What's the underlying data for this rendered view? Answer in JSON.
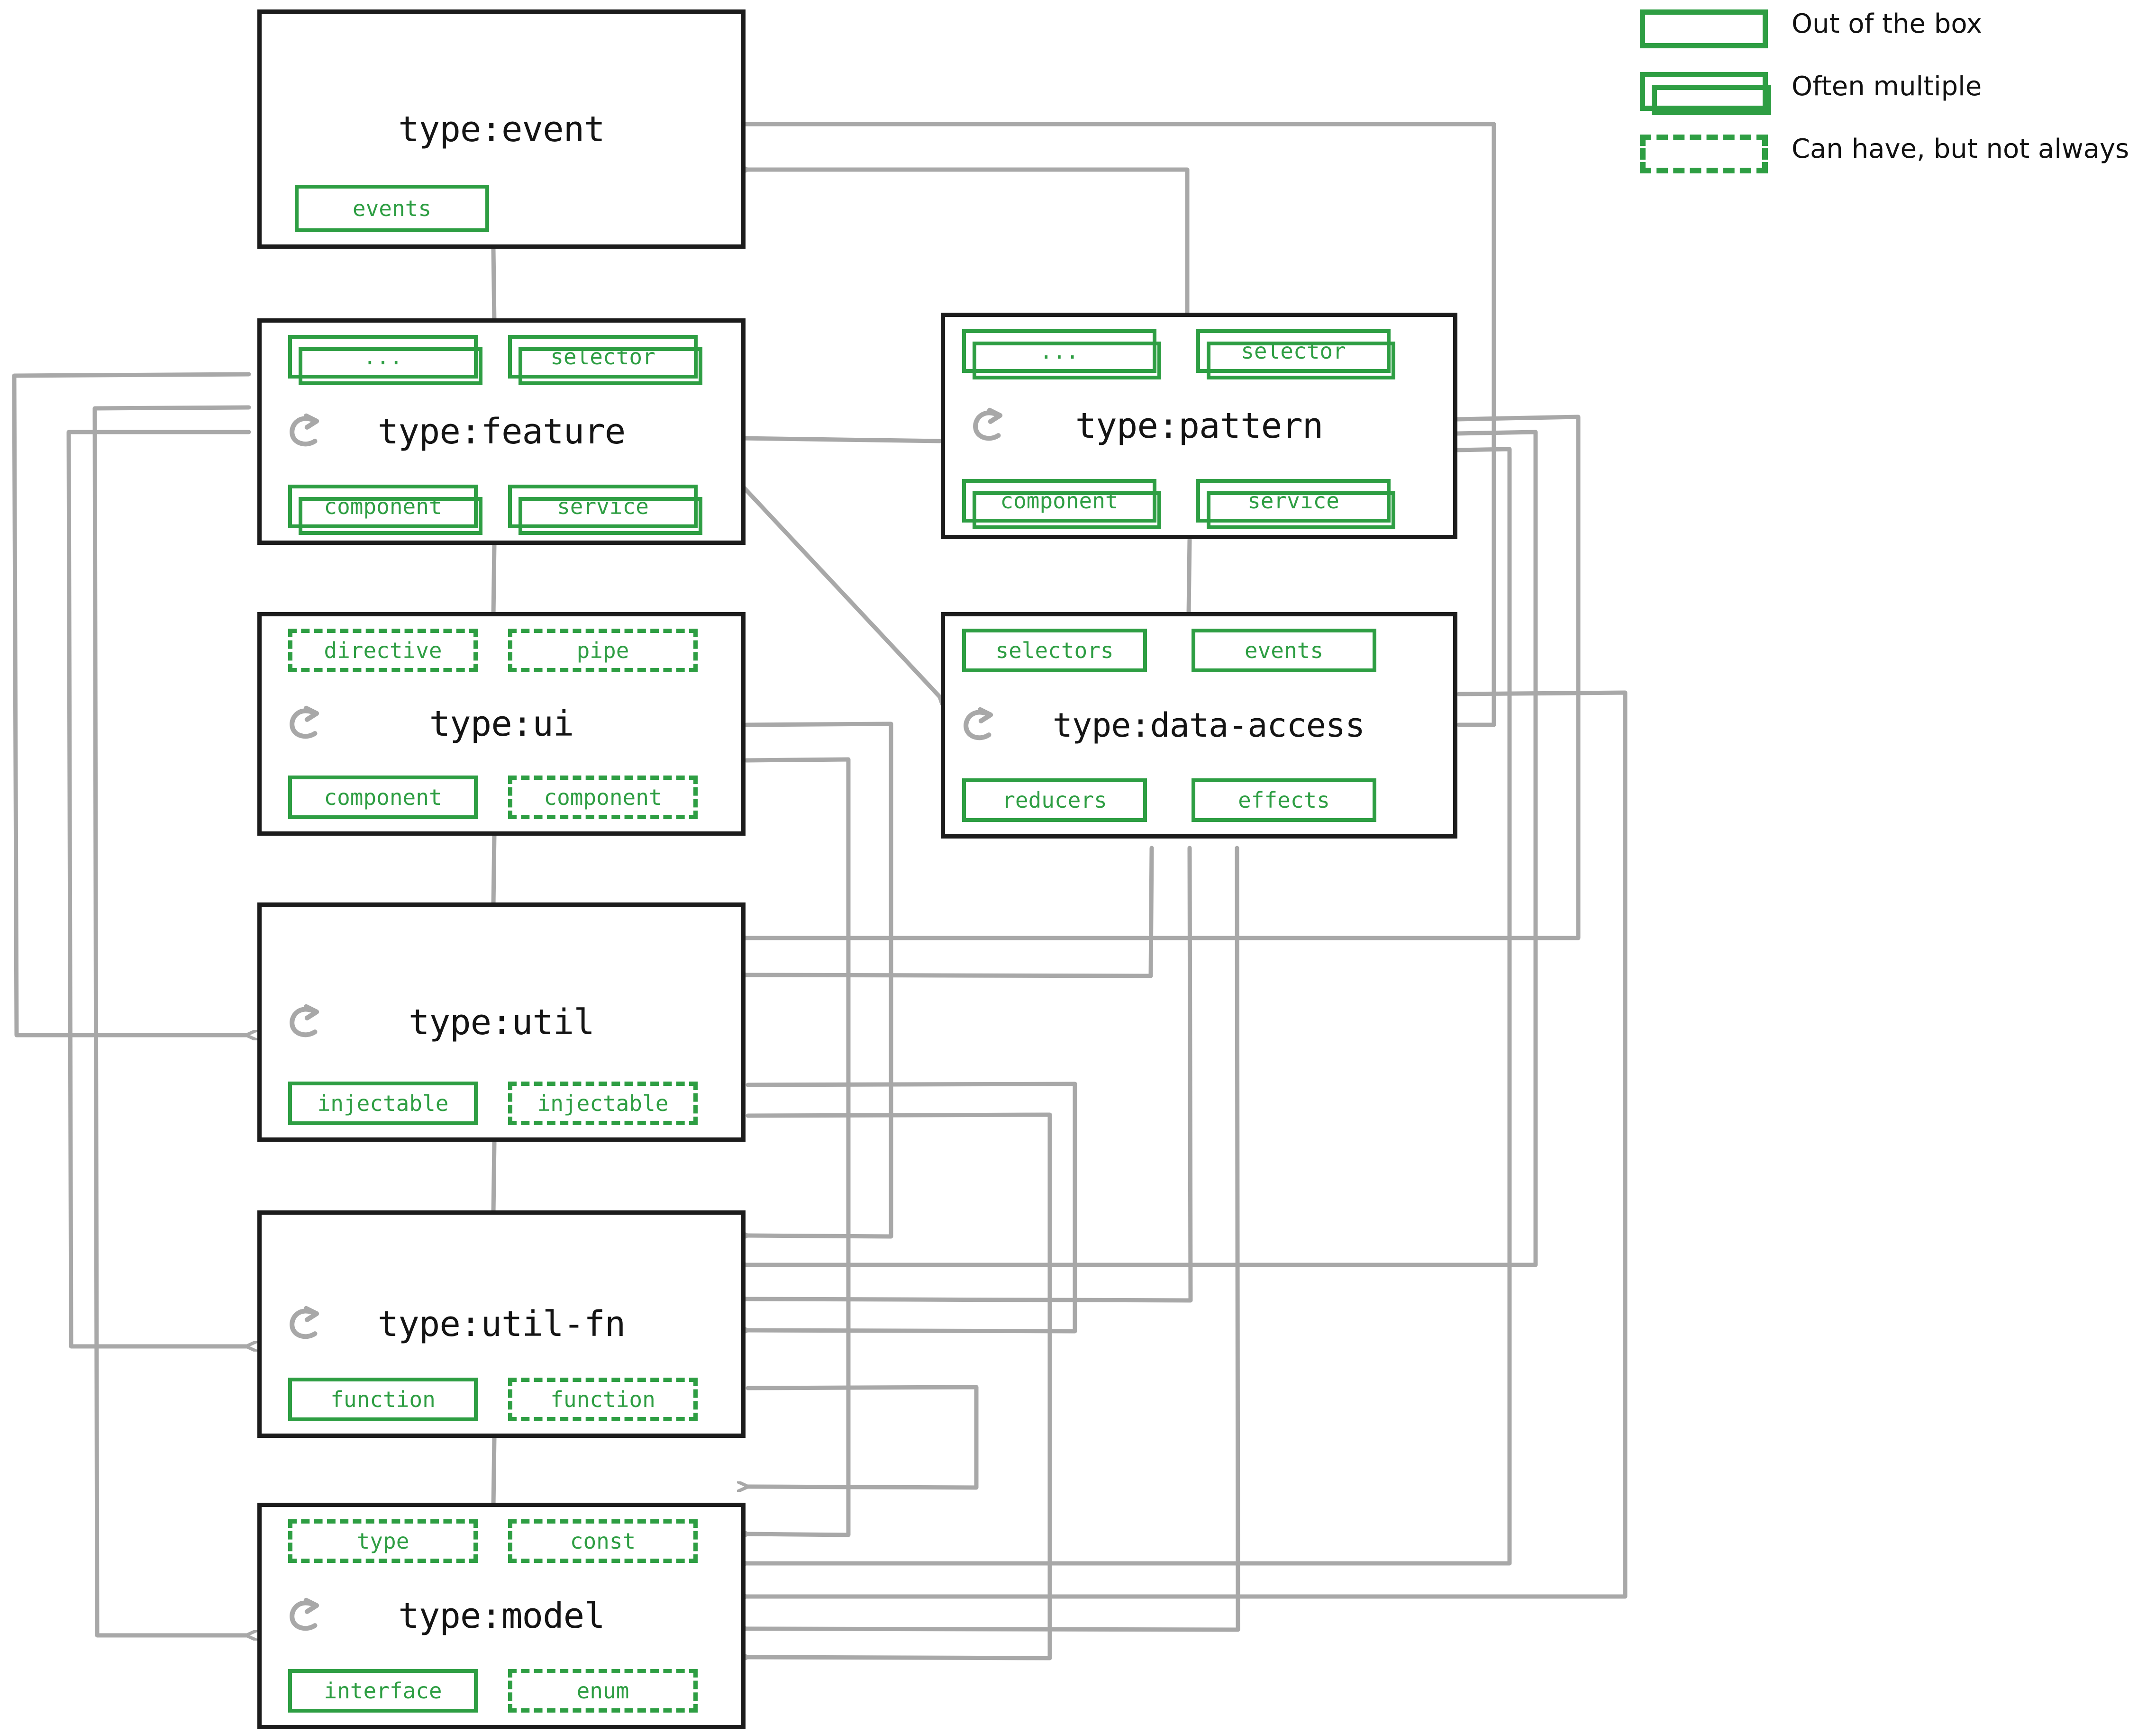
{
  "diagram": {
    "title": "Angular library type taxonomy and allowed dependencies",
    "colors": {
      "accent_green": "#2e9e43",
      "box_border": "#1c1c1c",
      "arrow_gray": "#a8a8a8",
      "background": "#ffffff"
    }
  },
  "legend": {
    "items": [
      {
        "style": "solid",
        "label": "Out of the box"
      },
      {
        "style": "multi",
        "label": "Often multiple"
      },
      {
        "style": "dashed",
        "label": "Can have, but not always"
      }
    ]
  },
  "nodes": [
    {
      "id": "event",
      "title": "type:event",
      "self_loop": false,
      "self_loop_icon": "circular-arrow-icon",
      "tags_top": [],
      "tags_bottom": [
        {
          "label": "events",
          "style": "solid"
        }
      ]
    },
    {
      "id": "feature",
      "title": "type:feature",
      "self_loop": true,
      "self_loop_icon": "circular-arrow-icon",
      "tags_top": [
        {
          "label": "...",
          "style": "multi"
        },
        {
          "label": "selector",
          "style": "multi"
        }
      ],
      "tags_bottom": [
        {
          "label": "component",
          "style": "multi"
        },
        {
          "label": "service",
          "style": "multi"
        }
      ]
    },
    {
      "id": "pattern",
      "title": "type:pattern",
      "self_loop": true,
      "self_loop_icon": "circular-arrow-icon",
      "tags_top": [
        {
          "label": "...",
          "style": "multi"
        },
        {
          "label": "selector",
          "style": "multi"
        }
      ],
      "tags_bottom": [
        {
          "label": "component",
          "style": "multi"
        },
        {
          "label": "service",
          "style": "multi"
        }
      ]
    },
    {
      "id": "ui",
      "title": "type:ui",
      "self_loop": true,
      "self_loop_icon": "circular-arrow-icon",
      "tags_top": [
        {
          "label": "directive",
          "style": "dashed"
        },
        {
          "label": "pipe",
          "style": "dashed"
        }
      ],
      "tags_bottom": [
        {
          "label": "component",
          "style": "solid"
        },
        {
          "label": "component",
          "style": "dashed"
        }
      ]
    },
    {
      "id": "data-access",
      "title": "type:data-access",
      "self_loop": true,
      "self_loop_icon": "circular-arrow-icon",
      "tags_top": [
        {
          "label": "selectors",
          "style": "solid"
        },
        {
          "label": "events",
          "style": "solid"
        }
      ],
      "tags_bottom": [
        {
          "label": "reducers",
          "style": "solid"
        },
        {
          "label": "effects",
          "style": "solid"
        }
      ]
    },
    {
      "id": "util",
      "title": "type:util",
      "self_loop": true,
      "self_loop_icon": "circular-arrow-icon",
      "tags_top": [],
      "tags_bottom": [
        {
          "label": "injectable",
          "style": "solid"
        },
        {
          "label": "injectable",
          "style": "dashed"
        }
      ]
    },
    {
      "id": "util-fn",
      "title": "type:util-fn",
      "self_loop": true,
      "self_loop_icon": "circular-arrow-icon",
      "tags_top": [],
      "tags_bottom": [
        {
          "label": "function",
          "style": "solid"
        },
        {
          "label": "function",
          "style": "dashed"
        }
      ]
    },
    {
      "id": "model",
      "title": "type:model",
      "self_loop": true,
      "self_loop_icon": "circular-arrow-icon",
      "tags_top": [
        {
          "label": "type",
          "style": "dashed"
        },
        {
          "label": "const",
          "style": "dashed"
        }
      ],
      "tags_bottom": [
        {
          "label": "interface",
          "style": "solid"
        },
        {
          "label": "enum",
          "style": "dashed"
        }
      ]
    }
  ],
  "edges": [
    {
      "from": "feature",
      "to": "event"
    },
    {
      "from": "feature",
      "to": "pattern"
    },
    {
      "from": "feature",
      "to": "ui"
    },
    {
      "from": "feature",
      "to": "data-access"
    },
    {
      "from": "feature",
      "to": "util"
    },
    {
      "from": "feature",
      "to": "util-fn"
    },
    {
      "from": "feature",
      "to": "model"
    },
    {
      "from": "pattern",
      "to": "data-access"
    },
    {
      "from": "pattern",
      "to": "util"
    },
    {
      "from": "pattern",
      "to": "util-fn"
    },
    {
      "from": "pattern",
      "to": "model"
    },
    {
      "from": "ui",
      "to": "util"
    },
    {
      "from": "ui",
      "to": "util-fn"
    },
    {
      "from": "ui",
      "to": "model"
    },
    {
      "from": "data-access",
      "to": "event"
    },
    {
      "from": "data-access",
      "to": "util"
    },
    {
      "from": "data-access",
      "to": "util-fn"
    },
    {
      "from": "data-access",
      "to": "model"
    },
    {
      "from": "util",
      "to": "util-fn"
    },
    {
      "from": "util",
      "to": "model"
    },
    {
      "from": "util-fn",
      "to": "model"
    }
  ]
}
